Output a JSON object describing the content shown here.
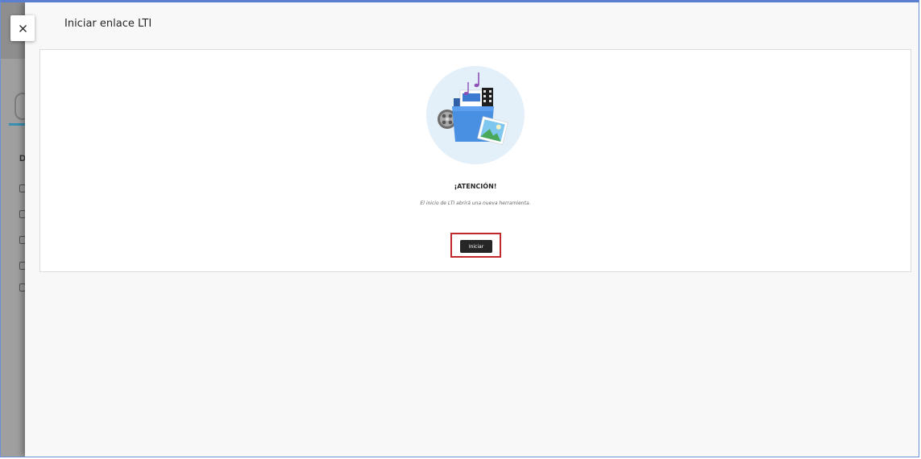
{
  "panel": {
    "title": "Iniciar enlace LTI",
    "close_icon": "close-icon"
  },
  "background": {
    "partial_letter": "D"
  },
  "content": {
    "illustration_icon": "media-folder-illustration",
    "heading": "¡ATENCIÓN!",
    "message": "El inicio de LTI abrirá una nueva herramienta.",
    "launch_button_label": "Iniciar"
  },
  "colors": {
    "highlight": "#c0282d",
    "button_bg": "#262626",
    "illustration_circle": "#e3eff9"
  }
}
